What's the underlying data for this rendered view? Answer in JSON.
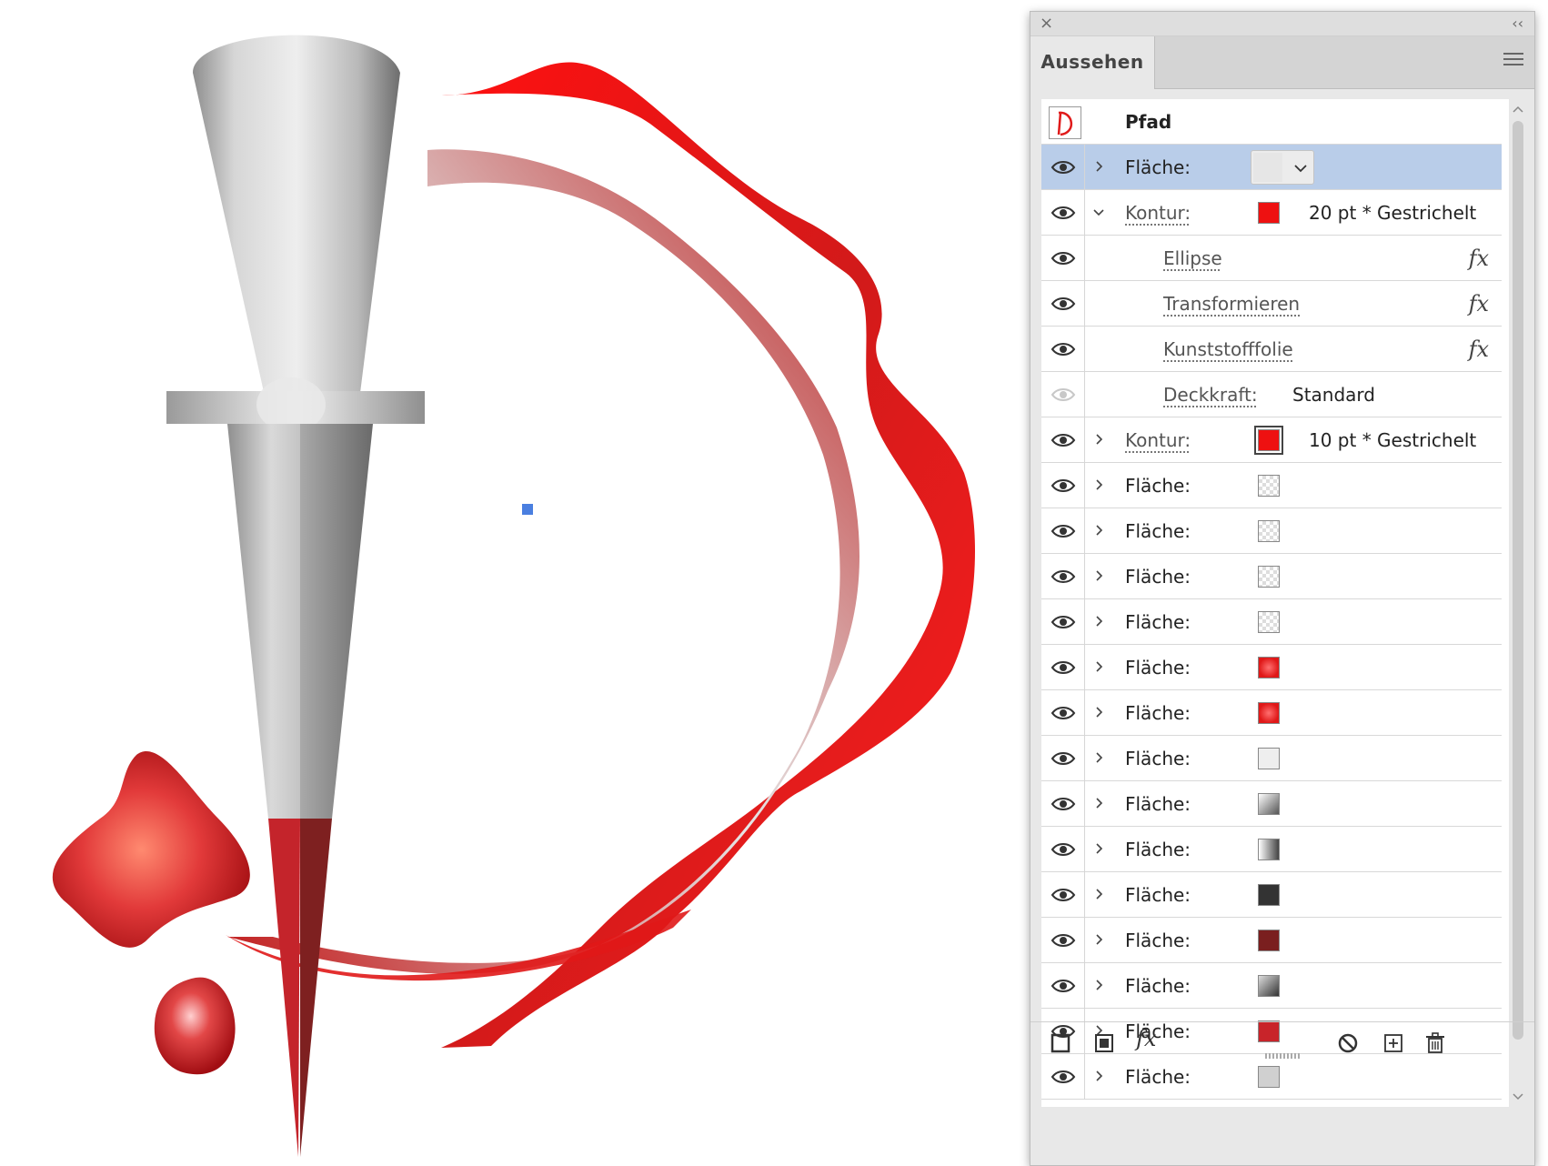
{
  "panel": {
    "title": "Aussehen",
    "close_glyph": "×",
    "collapse_glyph": "‹‹",
    "menu_icon": "hamburger-menu-icon"
  },
  "object_row": {
    "label": "Pfad",
    "thumbnail_icon": "path-thumbnail-icon"
  },
  "rows": [
    {
      "id": "flaeche-1",
      "kind": "fill",
      "label": "Fläche:",
      "swatch": "#e6e6e6",
      "selected": true,
      "dropdown": true,
      "expanded": false,
      "visible": true
    },
    {
      "id": "kontur-1",
      "kind": "stroke",
      "label": "Kontur:",
      "swatch": "#ee1111",
      "value": "20 pt * Gestrichelt",
      "expanded": true,
      "visible": true
    },
    {
      "id": "ellipse",
      "kind": "effect",
      "label": "Ellipse",
      "fx": "fx",
      "visible": true
    },
    {
      "id": "transformieren",
      "kind": "effect",
      "label": "Transformieren",
      "fx": "fx",
      "visible": true
    },
    {
      "id": "kunststofffolie",
      "kind": "effect",
      "label": "Kunststofffolie",
      "fx": "fx",
      "visible": true
    },
    {
      "id": "deckkraft",
      "kind": "opacity",
      "label": "Deckkraft:",
      "value": "Standard",
      "visible": false
    },
    {
      "id": "kontur-2",
      "kind": "stroke",
      "label": "Kontur:",
      "swatch": "#ee1111",
      "value": "10 pt * Gestrichelt",
      "expanded": false,
      "visible": true,
      "swatch_double": true
    },
    {
      "id": "flaeche-2",
      "kind": "fill",
      "label": "Fläche:",
      "swatch": "checker",
      "visible": true
    },
    {
      "id": "flaeche-3",
      "kind": "fill",
      "label": "Fläche:",
      "swatch": "checker",
      "visible": true
    },
    {
      "id": "flaeche-4",
      "kind": "fill",
      "label": "Fläche:",
      "swatch": "checker",
      "visible": true
    },
    {
      "id": "flaeche-5",
      "kind": "fill",
      "label": "Fläche:",
      "swatch": "checker",
      "visible": true
    },
    {
      "id": "flaeche-6",
      "kind": "fill",
      "label": "Fläche:",
      "swatch": "radial-red",
      "visible": true
    },
    {
      "id": "flaeche-7",
      "kind": "fill",
      "label": "Fläche:",
      "swatch": "radial-red",
      "visible": true
    },
    {
      "id": "flaeche-8",
      "kind": "fill",
      "label": "Fläche:",
      "swatch": "#eeeeee",
      "visible": true
    },
    {
      "id": "flaeche-9",
      "kind": "fill",
      "label": "Fläche:",
      "swatch": "gradient-gray",
      "visible": true
    },
    {
      "id": "flaeche-10",
      "kind": "fill",
      "label": "Fläche:",
      "swatch": "gradient-gray-h",
      "visible": true
    },
    {
      "id": "flaeche-11",
      "kind": "fill",
      "label": "Fläche:",
      "swatch": "#333333",
      "visible": true
    },
    {
      "id": "flaeche-12",
      "kind": "fill",
      "label": "Fläche:",
      "swatch": "#7a1f1f",
      "visible": true
    },
    {
      "id": "flaeche-13",
      "kind": "fill",
      "label": "Fläche:",
      "swatch": "gradient-dark",
      "visible": true
    },
    {
      "id": "flaeche-14",
      "kind": "fill",
      "label": "Fläche:",
      "swatch": "#c8242a",
      "visible": true
    },
    {
      "id": "flaeche-15",
      "kind": "fill",
      "label": "Fläche:",
      "swatch": "#d0d0d0",
      "visible": true
    }
  ],
  "bottom_toolbar": [
    {
      "id": "add-stroke",
      "icon": "add-new-stroke-icon"
    },
    {
      "id": "add-fill",
      "icon": "add-new-fill-icon"
    },
    {
      "id": "add-effect",
      "icon": "add-effect-fx-icon",
      "glyph": "fx"
    },
    {
      "id": "clear",
      "icon": "clear-appearance-icon"
    },
    {
      "id": "duplicate",
      "icon": "duplicate-item-icon"
    },
    {
      "id": "delete",
      "icon": "trash-icon"
    }
  ],
  "colors": {
    "accent_red": "#ee1111",
    "selection": "#b9cde9",
    "anchor_point": "#4a7fe0"
  }
}
